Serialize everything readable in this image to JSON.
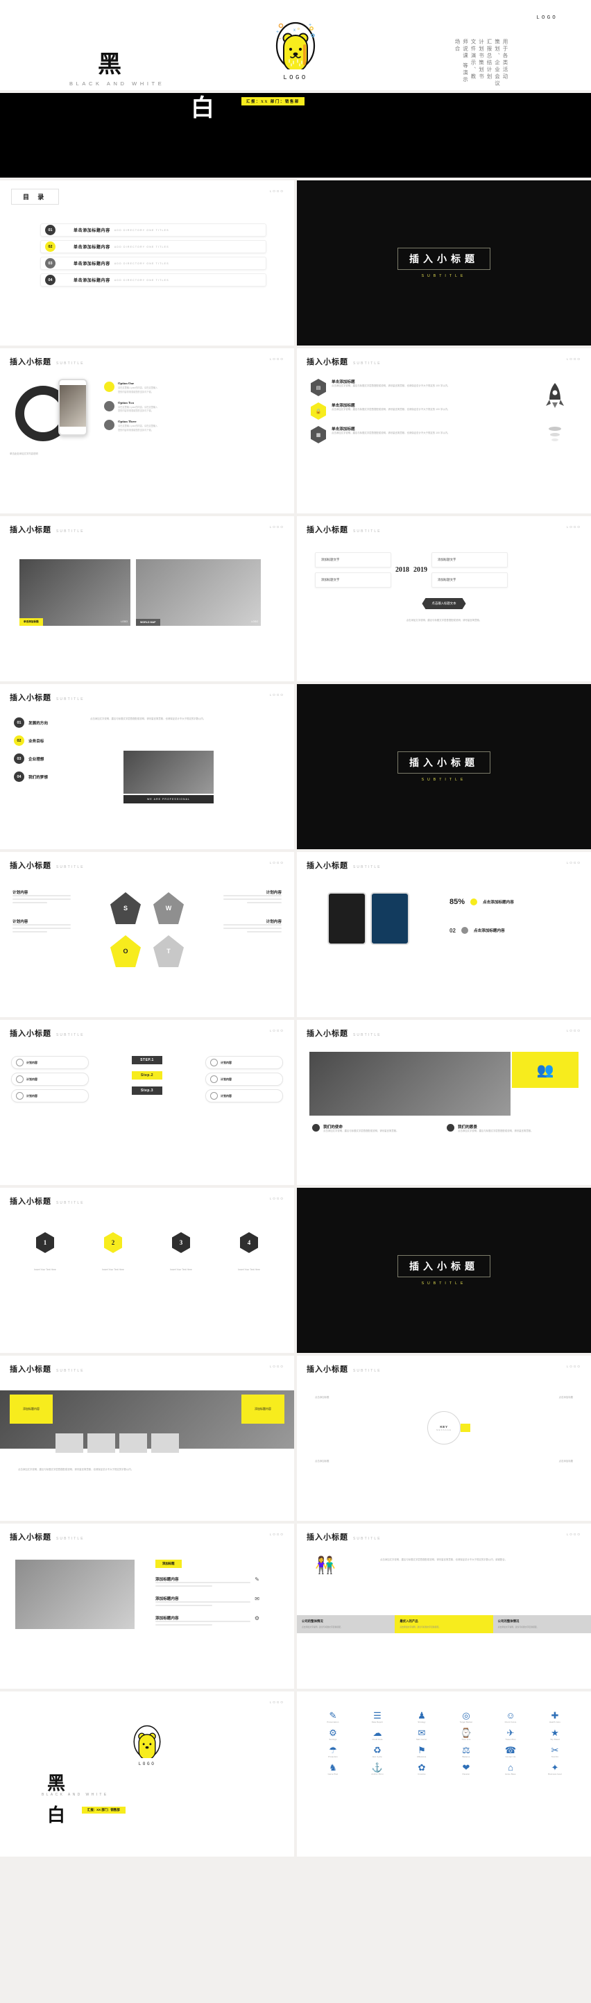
{
  "meta": {
    "logo_label": "LOGO",
    "subtitle_en": "SUBTITLE",
    "brand_yellow": "#F7EC1D",
    "brand_black": "#000000"
  },
  "cover": {
    "logo_top_right": "LOGO",
    "bear_logo_caption": "LOGO",
    "big_char": "黑",
    "latin_sub": "BLACK AND WHITE",
    "vertical_columns": [
      "用于各类活动",
      "策划、企业会议",
      "汇报总结计划",
      "计划书策划书",
      "文件演示、教",
      "师说课 等演示",
      "场合"
    ]
  },
  "cover_black": {
    "big_char": "白",
    "yellow_label": "汇报：XX  部门：销售部"
  },
  "directory": {
    "title": "目  录",
    "logo": "LOGO",
    "items": [
      {
        "num": "01",
        "cn": "单击添加标题内容",
        "en": "ADD DIRECTORY ONE TITLES",
        "style": "dark"
      },
      {
        "num": "02",
        "cn": "单击添加标题内容",
        "en": "ADD DIRECTORY ONE TITLES",
        "style": "yellow"
      },
      {
        "num": "03",
        "cn": "单击添加标题内容",
        "en": "ADD DIRECTORY ONE TITLES",
        "style": "grey"
      },
      {
        "num": "04",
        "cn": "单击添加标题内容",
        "en": "ADD DIRECTORY ONE TITLES",
        "style": "dark"
      }
    ]
  },
  "section_titles": {
    "cn": "插入小标题",
    "en": "SUBTITLE"
  },
  "slide_header": {
    "cn": "插入小标题",
    "en": "SUBTITLE",
    "logo": "LOGO"
  },
  "slides": {
    "phone_options": {
      "options": [
        {
          "label": "Option One",
          "desc": "请在这里输入your的内容，请在这里输入您的内容非常感谢您的支持与下载。"
        },
        {
          "label": "Option Two",
          "desc": "请在这里输入your的内容，请在这里输入您的内容非常感谢您的支持与下载。"
        },
        {
          "label": "Option Three",
          "desc": "请在这里输入your的内容，请在这里输入您的内容非常感谢您的支持与下载。"
        }
      ],
      "caption": "单击此处添加文字内容说明"
    },
    "hex_list": {
      "rows": [
        {
          "cn": "单击添加标题",
          "desc": "点击添加文字说明，建议与标题文字层叠搭配或说明，请尽量言简意赅，也请保证总计不大于规定的 100 字以内。"
        },
        {
          "cn": "单击添加标题",
          "desc": "点击添加文字说明，建议与标题文字层叠搭配或说明，请尽量言简意赅，也请保证总计不大于规定的 100 字以内。"
        },
        {
          "cn": "单击添加标题",
          "desc": "点击添加文字说明，建议与标题文字层叠搭配或说明，请尽量言简意赅，也请保证总计不大于规定的 100 字以内。"
        }
      ]
    },
    "photo_pair": {
      "left_tag": "单击添加标题",
      "left_badge": "LOGO",
      "right_tag": "WORLD MAP",
      "right_badge": "LOGO"
    },
    "year_compare": {
      "years": [
        "2018",
        "2019"
      ],
      "labels": [
        "添加标题文字",
        "添加标题文字",
        "添加标题文字",
        "添加标题文字"
      ],
      "footnote": "点击输入标题文本",
      "desc": "点击添加文字说明，建议与标题文字层叠搭配或说明，请尽量言简意赅。"
    },
    "four_points": {
      "items": [
        {
          "num": "01",
          "cn": "发展的方向",
          "style": "dark"
        },
        {
          "num": "02",
          "cn": "业务目标",
          "style": "yellow"
        },
        {
          "num": "03",
          "cn": "企业理想",
          "style": "dark"
        },
        {
          "num": "04",
          "cn": "我们的梦想",
          "style": "dark"
        }
      ],
      "photo_caption": "WE ARE PROFESSIONAL",
      "body": "点击添加文字说明，建议与标题文字层叠搭配或说明，请尽量言简意赅，也请保证总计不大于规定的字数以内。"
    },
    "swot": {
      "letters": [
        "S",
        "W",
        "O",
        "T"
      ],
      "blocks": [
        {
          "cn": "计划内容"
        },
        {
          "cn": "计划内容"
        },
        {
          "cn": "计划内容"
        },
        {
          "cn": "计划内容"
        }
      ]
    },
    "tablets": {
      "percent": "85%",
      "pct_label": "点击添加标题内容",
      "sub_num": "02",
      "sub_label": "点击添加标题内容"
    },
    "steps": {
      "steps": [
        "STEP.1",
        "Step.2",
        "Step.3"
      ],
      "cards": [
        "计划内容",
        "计划内容",
        "计划内容",
        "计划内容",
        "计划内容",
        "计划内容"
      ]
    },
    "bridge": {
      "left_title": "我们的使命",
      "right_title": "我们的愿景",
      "left_desc": "点击添加文字说明，建议与标题文字层叠搭配或说明，请尽量言简意赅。",
      "right_desc": "点击添加文字说明，建议与标题文字层叠搭配或说明，请尽量言简意赅。"
    },
    "numbered": {
      "items": [
        {
          "n": "1",
          "t": "Insert Your Text Here",
          "style": "dark"
        },
        {
          "n": "2",
          "t": "Insert Your Text Here",
          "style": "yellow"
        },
        {
          "n": "3",
          "t": "Insert Your Text Here",
          "style": "dark"
        },
        {
          "n": "4",
          "t": "Insert Your Text Here",
          "style": "dark"
        }
      ]
    },
    "city": {
      "left_label": "添加标题内容",
      "right_label": "添加标题内容",
      "body": "点击添加文字说明，建议与标题文字层叠搭配或说明，请尽量言简意赅，也请保证总计不大于规定的字数以内。"
    },
    "key_message": {
      "center_title": "KEY",
      "center_sub": "MESSAGE",
      "labels": [
        "点击添加标题",
        "点击添加标题",
        "点击添加标题",
        "点击添加标题"
      ]
    },
    "meeting": {
      "tag": "添加标题",
      "notes": [
        "添加标题内容",
        "添加标题内容",
        "添加标题内容"
      ]
    },
    "people": {
      "intro": "点击添加文字说明，建议与标题文字层叠搭配或说明，请尽量言简意赅，也请保证总计不大于规定的字数以内，谢谢配合。",
      "cols": [
        {
          "t": "公司的整体情况",
          "d": "点击添加文字说明，建议与标题文字层叠搭配。",
          "style": "grey"
        },
        {
          "t": "最优入的产品",
          "d": "点击添加文字说明，建议与标题文字层叠搭配。",
          "style": "yellow"
        },
        {
          "t": "公司的整体情况",
          "d": "点击添加文字说明，建议与标题文字层叠搭配。",
          "style": "grey"
        }
      ]
    },
    "end": {
      "big_char": "黑",
      "big_char2": "白",
      "latin": "BLACK AND WHITE",
      "yellow_label": "汇报：XX  部门：销售部",
      "logo_caption": "LOGO"
    },
    "icon_sheet": {
      "icons": [
        {
          "glyph": "✎",
          "caption": "Presentation"
        },
        {
          "glyph": "☰",
          "caption": "Data Report"
        },
        {
          "glyph": "♟",
          "caption": "Strategy"
        },
        {
          "glyph": "◎",
          "caption": "Target Market"
        },
        {
          "glyph": "☺",
          "caption": "Client Focus"
        },
        {
          "glyph": "✚",
          "caption": "Health Care"
        },
        {
          "glyph": "⚙",
          "caption": "Settings"
        },
        {
          "glyph": "☁",
          "caption": "Cloud Data"
        },
        {
          "glyph": "✉",
          "caption": "Mail Center"
        },
        {
          "glyph": "⌚",
          "caption": "Time Line"
        },
        {
          "glyph": "✈",
          "caption": "Travel Plan"
        },
        {
          "glyph": "★",
          "caption": "Top Rated"
        },
        {
          "glyph": "☂",
          "caption": "Protection"
        },
        {
          "glyph": "♻",
          "caption": "Eco Cycle"
        },
        {
          "glyph": "⚑",
          "caption": "Milestone"
        },
        {
          "glyph": "⚖",
          "caption": "Balance"
        },
        {
          "glyph": "☎",
          "caption": "Contact Us"
        },
        {
          "glyph": "✂",
          "caption": "Tool Kit"
        },
        {
          "glyph": "♞",
          "caption": "Game Plan"
        },
        {
          "glyph": "⚓",
          "caption": "Anchor Point"
        },
        {
          "glyph": "✿",
          "caption": "Creative"
        },
        {
          "glyph": "❤",
          "caption": "Passion"
        },
        {
          "glyph": "⌂",
          "caption": "Home Base"
        },
        {
          "glyph": "✦",
          "caption": "Business Goal"
        }
      ]
    }
  }
}
